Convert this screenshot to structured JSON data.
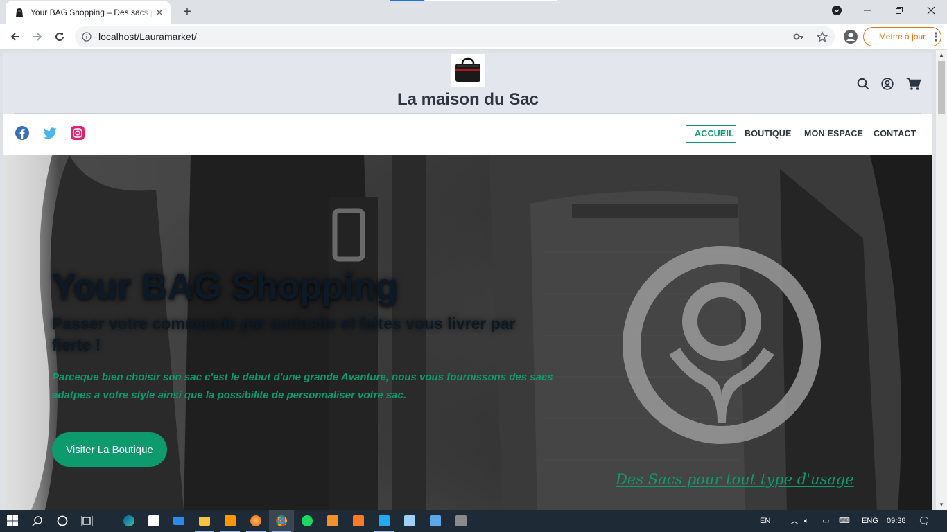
{
  "browser": {
    "tab_title": "Your BAG Shopping – Des sacs pour tout type d'usage",
    "url": "localhost/Lauramarket/",
    "update_button": "Mettre à jour"
  },
  "site": {
    "title": "La maison du Sac",
    "nav": [
      "ACCUEIL",
      "BOUTIQUE",
      "MON ESPACE",
      "CONTACT"
    ],
    "active_nav": "ACCUEIL",
    "accent_color": "#0d9b6e",
    "social": [
      "facebook-icon",
      "twitter-icon",
      "instagram-icon"
    ]
  },
  "hero": {
    "title": "Your BAG Shopping",
    "subtitle": "Passer votre commande par curiosite et faites vous livrer par fierte !",
    "description": "Parceque bien choisir son sac c'est le debut d'une grande Avanture, nous vous fournissons des sacs adatpes a votre style ainsi que la possibilite de personnaliser votre sac.",
    "button": "Visiter La Boutique",
    "caption": "Des Sacs pour tout type d'usage"
  },
  "taskbar": {
    "language": "EN",
    "keyboard": "ENG",
    "time": "09:38"
  }
}
